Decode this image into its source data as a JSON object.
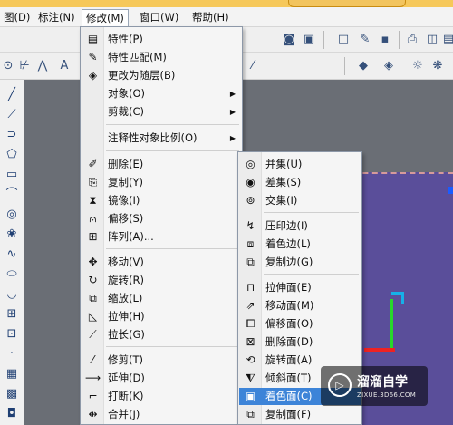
{
  "menubar": {
    "items": [
      "图(D)",
      "标注(N)",
      "修改(M)",
      "窗口(W)",
      "帮助(H)"
    ],
    "active": "修改(M)"
  },
  "toolbar_top": {
    "icons": [
      "render-icon",
      "materials-icon",
      "view-icon",
      "new-file-icon",
      "open-file-icon",
      "save-icon",
      "print-icon",
      "preview-icon"
    ]
  },
  "toolbar_second": {
    "icons": [
      "orbit-icon",
      "snap-icon",
      "osnap-icon",
      "text-style-icon",
      "dim-style-icon",
      "layer-icon",
      "properties-icon"
    ]
  },
  "left_toolbar": {
    "icons": [
      "line-icon",
      "construction-line-icon",
      "polyline-icon",
      "polygon-icon",
      "rectangle-icon",
      "arc-icon",
      "circle-icon",
      "revision-cloud-icon",
      "spline-icon",
      "ellipse-icon",
      "ellipse-arc-icon",
      "insert-block-icon",
      "make-block-icon",
      "point-icon",
      "hatch-icon",
      "gradient-icon",
      "region-icon"
    ]
  },
  "modify_menu": {
    "items": [
      {
        "label": "特性(P)",
        "icon": "properties-icon"
      },
      {
        "label": "特性匹配(M)",
        "icon": "match-properties-icon"
      },
      {
        "label": "更改为随层(B)",
        "icon": "set-bylayer-icon"
      },
      {
        "label": "对象(O)",
        "submenu": true
      },
      {
        "label": "剪裁(C)",
        "submenu": true
      },
      {
        "label": "注释性对象比例(O)",
        "submenu": true
      },
      {
        "label": "删除(E)",
        "icon": "erase-icon"
      },
      {
        "label": "复制(Y)",
        "icon": "copy-icon"
      },
      {
        "label": "镜像(I)",
        "icon": "mirror-icon"
      },
      {
        "label": "偏移(S)",
        "icon": "offset-icon"
      },
      {
        "label": "阵列(A)...",
        "icon": "array-icon"
      },
      {
        "label": "移动(V)",
        "icon": "move-icon"
      },
      {
        "label": "旋转(R)",
        "icon": "rotate-icon"
      },
      {
        "label": "缩放(L)",
        "icon": "scale-icon"
      },
      {
        "label": "拉伸(H)",
        "icon": "stretch-icon"
      },
      {
        "label": "拉长(G)",
        "icon": "lengthen-icon"
      },
      {
        "label": "修剪(T)",
        "icon": "trim-icon"
      },
      {
        "label": "延伸(D)",
        "icon": "extend-icon"
      },
      {
        "label": "打断(K)",
        "icon": "break-icon"
      },
      {
        "label": "合并(J)",
        "icon": "join-icon"
      }
    ]
  },
  "solid_editing_menu": {
    "items": [
      {
        "label": "并集(U)",
        "icon": "union-icon"
      },
      {
        "label": "差集(S)",
        "icon": "subtract-icon"
      },
      {
        "label": "交集(I)",
        "icon": "intersect-icon"
      },
      {
        "label": "压印边(I)",
        "icon": "imprint-icon"
      },
      {
        "label": "着色边(L)",
        "icon": "color-edges-icon"
      },
      {
        "label": "复制边(G)",
        "icon": "copy-edges-icon"
      },
      {
        "label": "拉伸面(E)",
        "icon": "extrude-faces-icon"
      },
      {
        "label": "移动面(M)",
        "icon": "move-faces-icon"
      },
      {
        "label": "偏移面(O)",
        "icon": "offset-faces-icon"
      },
      {
        "label": "删除面(D)",
        "icon": "delete-faces-icon"
      },
      {
        "label": "旋转面(A)",
        "icon": "rotate-faces-icon"
      },
      {
        "label": "倾斜面(T)",
        "icon": "taper-faces-icon"
      },
      {
        "label": "着色面(C)",
        "icon": "color-faces-icon",
        "highlighted": true
      },
      {
        "label": "复制面(F)",
        "icon": "copy-faces-icon"
      }
    ]
  },
  "watermark": {
    "brand": "溜溜自学",
    "url": "ZIXUE.3D66.COM",
    "logo": "▷"
  },
  "colors": {
    "highlight": "#3d84d8",
    "canvas": "#6a6e75",
    "work_plane": "#5a4e9a",
    "axis_x": "#e22222",
    "axis_y": "#28d82a",
    "axis_z": "#16b0e8"
  }
}
